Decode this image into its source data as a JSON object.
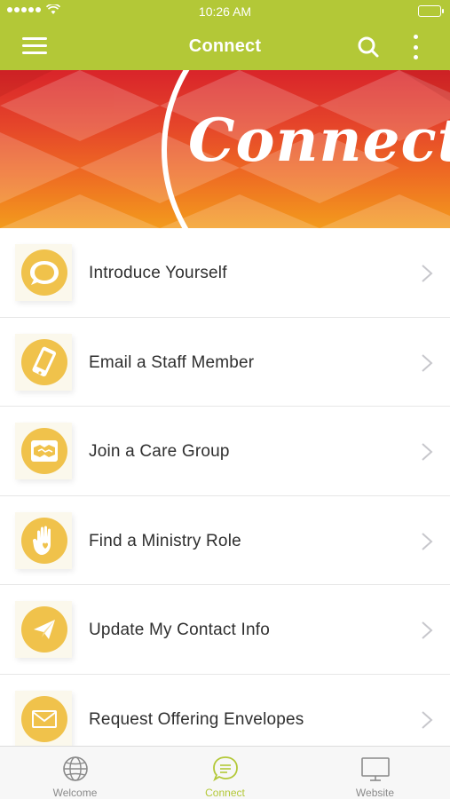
{
  "status_bar": {
    "time": "10:26 AM"
  },
  "app_bar": {
    "title": "Connect"
  },
  "banner": {
    "text": "Connect"
  },
  "list": {
    "items": [
      {
        "label": "Introduce Yourself",
        "icon": "speech-bubble-icon"
      },
      {
        "label": "Email a Staff Member",
        "icon": "phone-icon"
      },
      {
        "label": "Join a Care Group",
        "icon": "handshake-icon"
      },
      {
        "label": "Find a Ministry Role",
        "icon": "hand-heart-icon"
      },
      {
        "label": "Update My Contact Info",
        "icon": "paper-plane-icon"
      },
      {
        "label": "Request Offering Envelopes",
        "icon": "envelope-icon"
      }
    ]
  },
  "tabs": [
    {
      "label": "Welcome",
      "icon": "globe-icon",
      "active": false
    },
    {
      "label": "Connect",
      "icon": "chat-icon",
      "active": true
    },
    {
      "label": "Website",
      "icon": "monitor-icon",
      "active": false
    }
  ],
  "colors": {
    "accent": "#b3c837",
    "icon_fill": "#f0c24b",
    "banner_red": "#d9242a",
    "banner_orange": "#f39b1d"
  }
}
